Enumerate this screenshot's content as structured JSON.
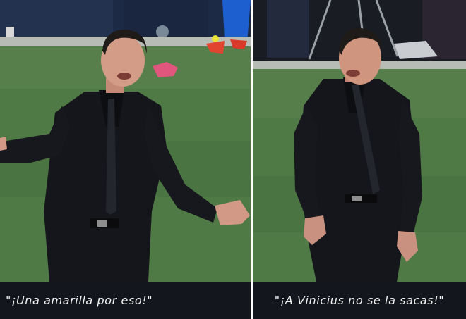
{
  "panels": [
    {
      "caption": "\"¡Una amarilla por eso!\""
    },
    {
      "caption": "\"¡A Vinicius no se la sacas!\""
    }
  ],
  "colors": {
    "pitch": "#4f7a45",
    "suit": "#15161b",
    "caption_bar": "#13161d",
    "caption_text": "#f2f2f2"
  }
}
